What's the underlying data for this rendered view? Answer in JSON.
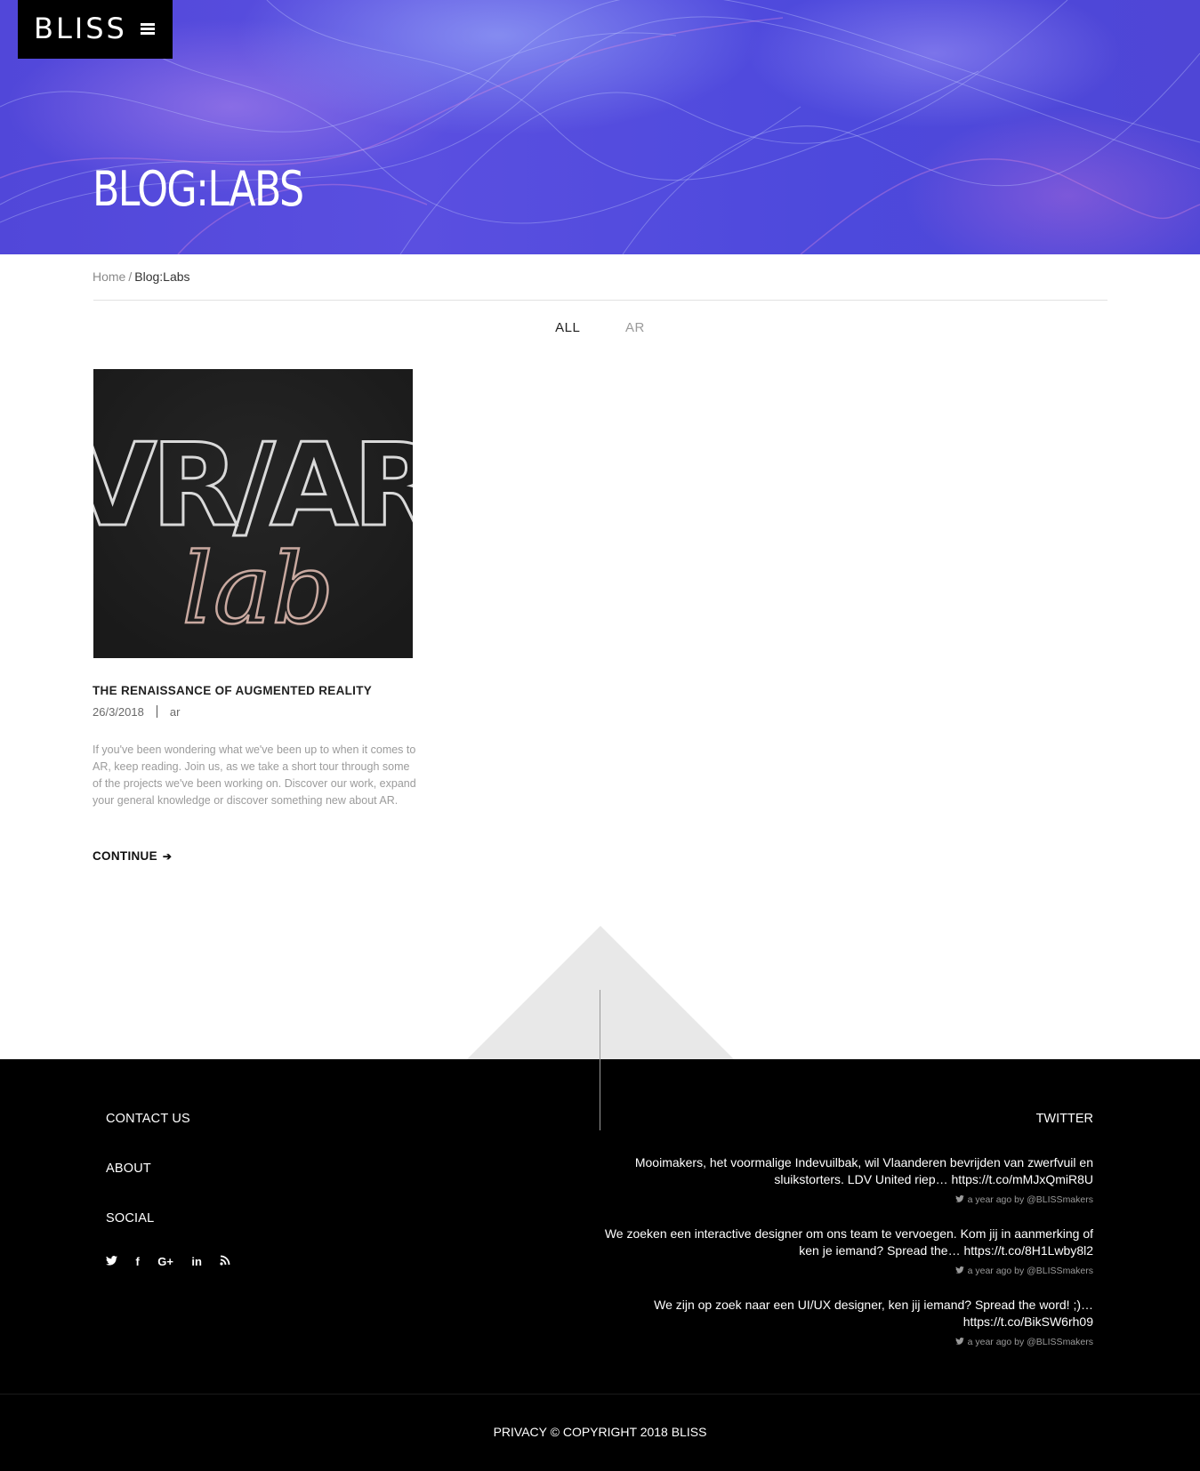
{
  "header": {
    "logo": "BLISS",
    "menu_icon": "hamburger-menu-icon",
    "page_title": "BLOG:LABS"
  },
  "breadcrumb": {
    "home": "Home",
    "separator": "/",
    "current": "Blog:Labs"
  },
  "filters": [
    {
      "label": "ALL",
      "active": true
    },
    {
      "label": "AR",
      "active": false
    }
  ],
  "post": {
    "image_text_top": "VR/AR",
    "image_text_bottom": "lab",
    "title": "THE RENAISSANCE OF AUGMENTED REALITY",
    "date": "26/3/2018",
    "category": "ar",
    "excerpt": "If you've been wondering what we've been up to when it comes to AR, keep reading. Join us, as we take a short tour through some of the projects we've been working on. Discover our work, expand your general knowledge or discover something new about AR.",
    "continue_label": "CONTINUE",
    "continue_icon": "arrow-right-icon"
  },
  "footer": {
    "links": [
      "CONTACT US",
      "ABOUT",
      "SOCIAL"
    ],
    "social_icons": [
      {
        "name": "twitter-icon",
        "glyph": "🐦"
      },
      {
        "name": "facebook-icon",
        "glyph": "f"
      },
      {
        "name": "google-plus-icon",
        "glyph": "G+"
      },
      {
        "name": "linkedin-icon",
        "glyph": "in"
      },
      {
        "name": "rss-icon",
        "glyph": "))"
      }
    ],
    "twitter_heading": "TWITTER",
    "tweets": [
      {
        "text": "Mooimakers, het voormalige Indevuilbak, wil Vlaanderen bevrijden van zwerfvuil en sluikstorters. LDV United riep… https://t.co/mMJxQmiR8U",
        "meta": "a year ago by @BLISSmakers"
      },
      {
        "text": "We zoeken een interactive designer om ons team te vervoegen. Kom jij in aanmerking of ken je iemand? Spread the… https://t.co/8H1Lwby8l2",
        "meta": "a year ago by @BLISSmakers"
      },
      {
        "text": "We zijn op zoek naar een UI/UX designer, ken jij iemand? Spread the word! ;)… https://t.co/BikSW6rh09",
        "meta": "a year ago by @BLISSmakers"
      }
    ],
    "copyright": "PRIVACY © COPYRIGHT 2018 BLISS"
  }
}
